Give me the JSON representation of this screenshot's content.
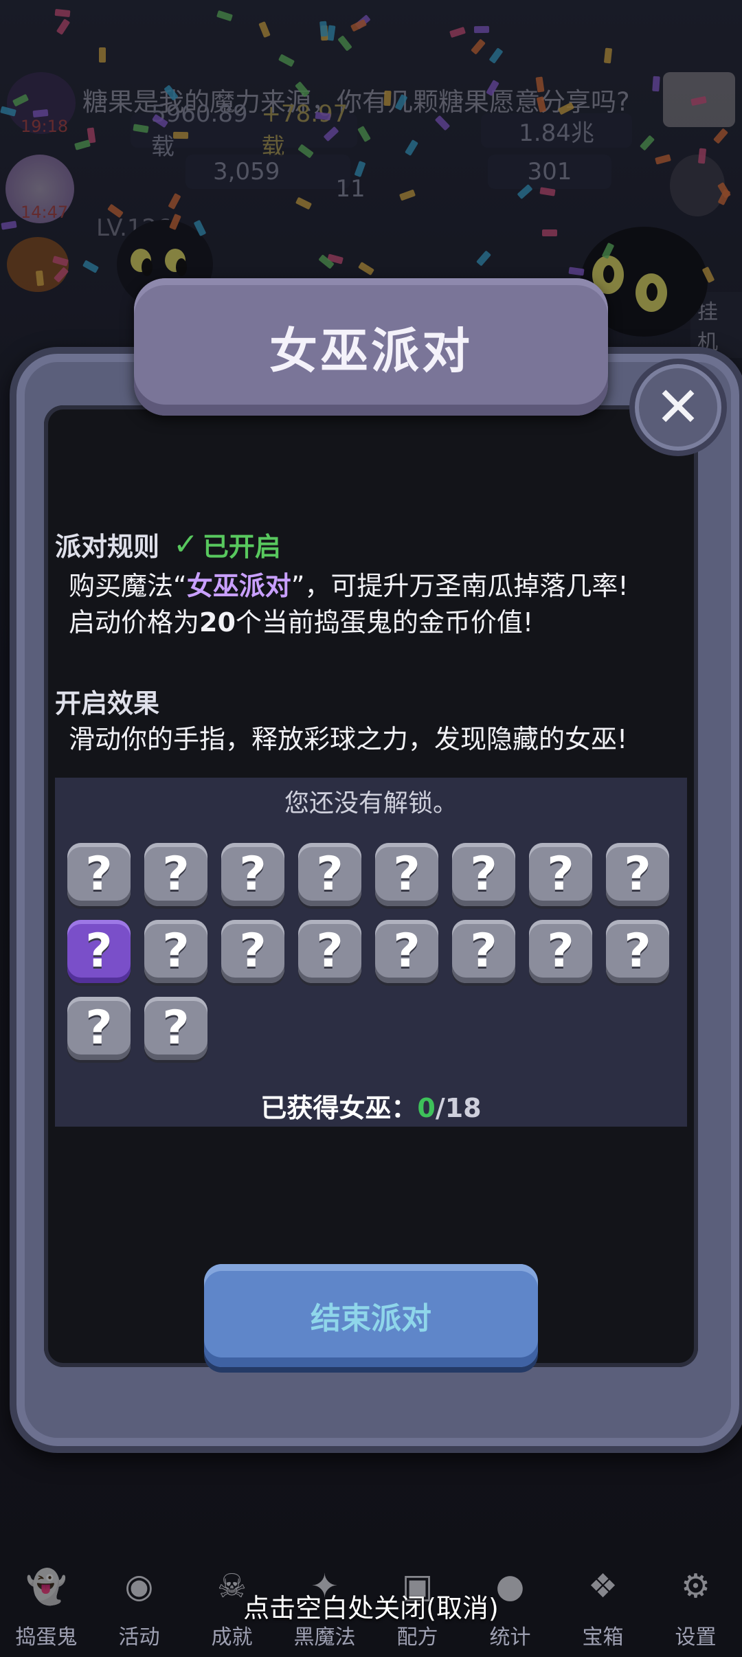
{
  "background": {
    "top_message": "糖果是我的魔力来源，你有几颗糖果愿意分享吗?",
    "hud_gold": "5960.89载",
    "hud_gold_rate": "+78.97载",
    "hud_value": "1.84兆",
    "hud_count_a": "3,059",
    "hud_count_b": "301",
    "hud_count_c": "11",
    "level": "LV.126",
    "idle_label": "挂机",
    "timer_a": "19:18",
    "timer_b": "14:47"
  },
  "modal": {
    "title": "女巫派对",
    "close_icon": "close-x-icon",
    "rules_heading": "派对规则",
    "rules_status": "已开启",
    "rules_line1_prefix": "购买魔法“",
    "rules_line1_highlight": "女巫派对",
    "rules_line1_suffix": "”，可提升万圣南瓜掉落几率!",
    "rules_line2_prefix": "启动价格为",
    "rules_line2_bold": "20",
    "rules_line2_suffix": "个当前捣蛋鬼的金币价值!",
    "effect_heading": "开启效果",
    "effect_line": "滑动你的手指，释放彩球之力，发现隐藏的女巫!",
    "unlock_note": "您还没有解锁。",
    "slot_glyph": "?",
    "slots_total": 18,
    "active_slot_index": 8,
    "count_label": "已获得女巫：",
    "count_got": "0",
    "count_sep": "/",
    "count_total": "18",
    "end_button": "结束派对"
  },
  "close_hint": "点击空白处关闭(取消)",
  "nav": {
    "items": [
      {
        "label": "捣蛋鬼",
        "icon": "ghost-icon"
      },
      {
        "label": "活动",
        "icon": "eyeball-cake-icon"
      },
      {
        "label": "成就",
        "icon": "skull-trophy-icon"
      },
      {
        "label": "黑魔法",
        "icon": "spellbook-icon"
      },
      {
        "label": "配方",
        "icon": "recipe-chest-icon"
      },
      {
        "label": "统计",
        "icon": "crystal-ball-icon"
      },
      {
        "label": "宝箱",
        "icon": "gift-box-icon"
      },
      {
        "label": "设置",
        "icon": "gear-icon"
      }
    ]
  },
  "colors": {
    "enabled_green": "#58c85e",
    "highlight_purple": "#c9a0ff",
    "button_blue": "#5f86c9",
    "active_slot_purple": "#7a4fc9"
  }
}
